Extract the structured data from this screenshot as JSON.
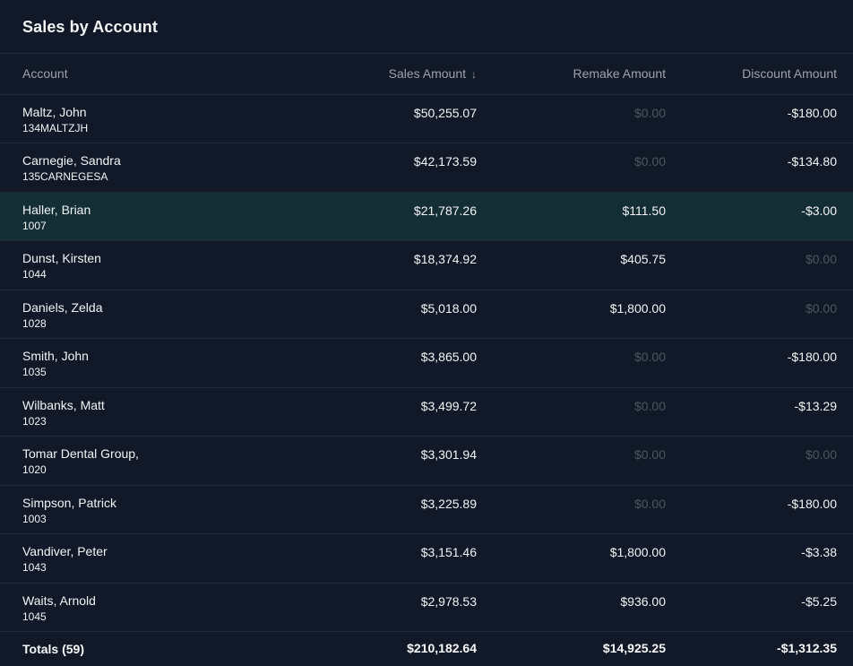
{
  "panel": {
    "title": "Sales by Account"
  },
  "columns": {
    "account": "Account",
    "sales": "Sales Amount",
    "sales_sort_icon": "↓",
    "remake": "Remake Amount",
    "discount": "Discount Amount"
  },
  "rows": [
    {
      "name": "Maltz, John",
      "id": "134MALTZJH",
      "sales": "$50,255.07",
      "remake": "$0.00",
      "discount": "-$180.00"
    },
    {
      "name": "Carnegie, Sandra",
      "id": "135CARNEGESA",
      "sales": "$42,173.59",
      "remake": "$0.00",
      "discount": "-$134.80"
    },
    {
      "name": "Haller, Brian",
      "id": "1007",
      "sales": "$21,787.26",
      "remake": "$111.50",
      "discount": "-$3.00"
    },
    {
      "name": "Dunst, Kirsten",
      "id": "1044",
      "sales": "$18,374.92",
      "remake": "$405.75",
      "discount": "$0.00"
    },
    {
      "name": "Daniels, Zelda",
      "id": "1028",
      "sales": "$5,018.00",
      "remake": "$1,800.00",
      "discount": "$0.00"
    },
    {
      "name": "Smith, John",
      "id": "1035",
      "sales": "$3,865.00",
      "remake": "$0.00",
      "discount": "-$180.00"
    },
    {
      "name": "Wilbanks, Matt",
      "id": "1023",
      "sales": "$3,499.72",
      "remake": "$0.00",
      "discount": "-$13.29"
    },
    {
      "name": "Tomar Dental Group,",
      "id": "1020",
      "sales": "$3,301.94",
      "remake": "$0.00",
      "discount": "$0.00"
    },
    {
      "name": "Simpson, Patrick",
      "id": "1003",
      "sales": "$3,225.89",
      "remake": "$0.00",
      "discount": "-$180.00"
    },
    {
      "name": "Vandiver, Peter",
      "id": "1043",
      "sales": "$3,151.46",
      "remake": "$1,800.00",
      "discount": "-$3.38"
    },
    {
      "name": "Waits, Arnold",
      "id": "1045",
      "sales": "$2,978.53",
      "remake": "$936.00",
      "discount": "-$5.25"
    }
  ],
  "totals": {
    "label": "Totals (59)",
    "sales": "$210,182.64",
    "remake": "$14,925.25",
    "discount": "-$1,312.35"
  },
  "colors": {
    "background": "#111827",
    "highlight_row": "#132e35",
    "muted_value": "#4b5563",
    "divider": "#1f2937"
  }
}
